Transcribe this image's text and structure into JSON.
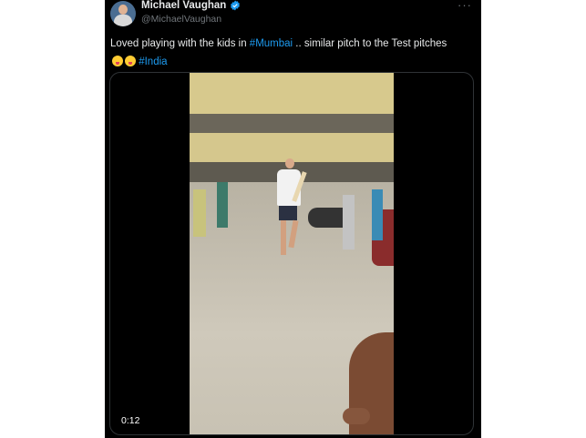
{
  "tweet": {
    "author_name": "Michael Vaughan",
    "handle": "@MichaelVaughan",
    "more_label": "···",
    "text_part1": "Loved playing with the kids in ",
    "hashtag1": "#Mumbai",
    "text_part2": " .. similar pitch to the Test pitches ",
    "hashtag2": "#India"
  },
  "video": {
    "timestamp": "0:12"
  },
  "colors": {
    "background": "#000000",
    "hashtag": "#1d9bf0",
    "verified": "#1d9bf0"
  },
  "icons": {
    "verified": "verified-badge-icon",
    "more": "more-options-icon"
  }
}
